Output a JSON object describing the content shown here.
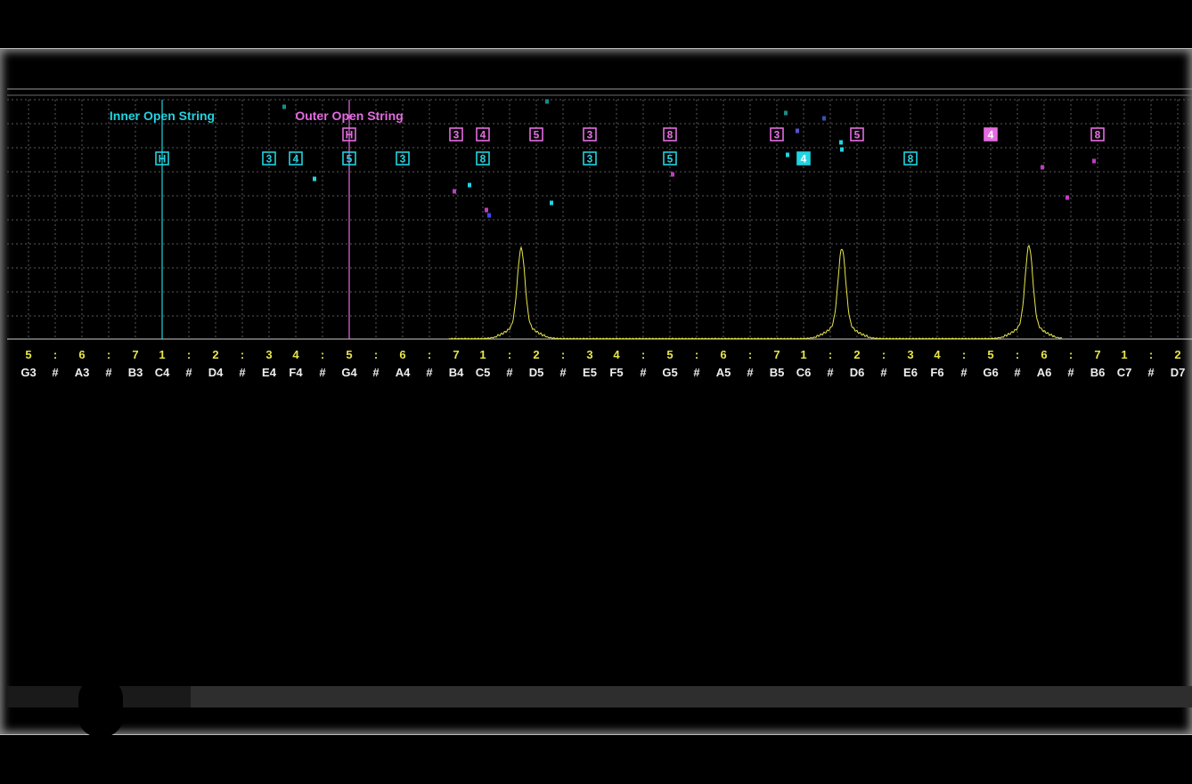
{
  "labels": {
    "inner_open_string": "Inner Open String",
    "outer_open_string": "Outer Open String"
  },
  "colors": {
    "background": "#000000",
    "grid": "#5a5a5a",
    "inner": "#22d3e0",
    "outer": "#e46ce0",
    "spectrum": "#e8e64a",
    "degree_text": "#e8e64a",
    "note_text": "#eeeeee"
  },
  "axis": {
    "start_pitch": "G3",
    "semitones_per_column": 1,
    "degrees": [
      "5",
      ":",
      "6",
      ":",
      "7",
      "1",
      ":",
      "2",
      ":",
      "3",
      "4",
      ":",
      "5",
      ":",
      "6",
      ":",
      "7",
      "1",
      ":",
      "2",
      ":",
      "3",
      "4",
      ":",
      "5",
      ":",
      "6",
      ":",
      "7",
      "1",
      ":",
      "2",
      ":",
      "3",
      "4",
      ":",
      "5",
      ":",
      "6",
      ":",
      "7",
      "1",
      ":",
      "2"
    ],
    "notes": [
      "G3",
      "#",
      "A3",
      "#",
      "B3",
      "C4",
      "#",
      "D4",
      "#",
      "E4",
      "F4",
      "#",
      "G4",
      "#",
      "A4",
      "#",
      "B4",
      "C5",
      "#",
      "D5",
      "#",
      "E5",
      "F5",
      "#",
      "G5",
      "#",
      "A5",
      "#",
      "B5",
      "C6",
      "#",
      "D6",
      "#",
      "E6",
      "F6",
      "#",
      "G6",
      "#",
      "A6",
      "#",
      "B6",
      "C7",
      "#",
      "D7"
    ]
  },
  "open_strings": {
    "inner": "C4",
    "outer": "G4"
  },
  "inner_markers": [
    {
      "note": "C4",
      "label": "H",
      "filled": false
    },
    {
      "note": "E4",
      "label": "3",
      "filled": false
    },
    {
      "note": "F4",
      "label": "4",
      "filled": false
    },
    {
      "note": "G4",
      "label": "5",
      "filled": false
    },
    {
      "note": "A4",
      "label": "3",
      "filled": false
    },
    {
      "note": "C5",
      "label": "8",
      "filled": false
    },
    {
      "note": "E5",
      "label": "3",
      "filled": false
    },
    {
      "note": "G5",
      "label": "5",
      "filled": false
    },
    {
      "note": "C6",
      "label": "4",
      "filled": true
    },
    {
      "note": "E6",
      "label": "8",
      "filled": false
    }
  ],
  "outer_markers": [
    {
      "note": "G4",
      "label": "H",
      "filled": false
    },
    {
      "note": "B4",
      "label": "3",
      "filled": false
    },
    {
      "note": "C5",
      "label": "4",
      "filled": false
    },
    {
      "note": "D5",
      "label": "5",
      "filled": false
    },
    {
      "note": "E5",
      "label": "3",
      "filled": false
    },
    {
      "note": "G5",
      "label": "8",
      "filled": false
    },
    {
      "note": "B5",
      "label": "3",
      "filled": false
    },
    {
      "note": "D6",
      "label": "5",
      "filled": false
    },
    {
      "note": "G6",
      "label": "4",
      "filled": true
    },
    {
      "note": "B6",
      "label": "8",
      "filled": false
    }
  ],
  "spectrum_peaks": [
    {
      "note": "D5",
      "level": 0.97
    },
    {
      "note": "D6",
      "level": 0.97
    },
    {
      "note": "A6",
      "level": 1.0
    }
  ]
}
